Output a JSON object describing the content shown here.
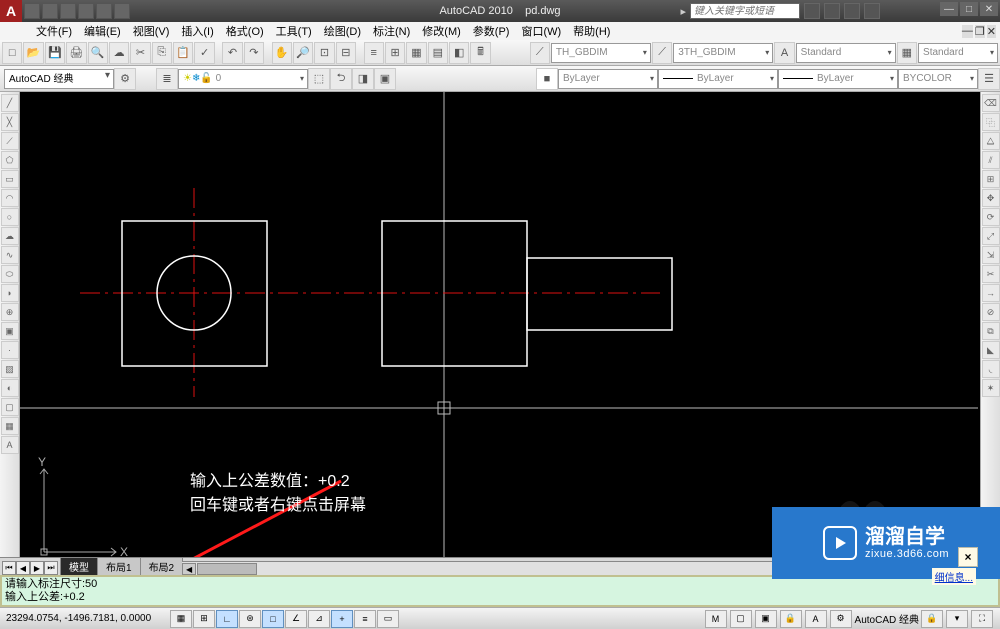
{
  "title": {
    "app": "AutoCAD 2010",
    "file": "pd.dwg"
  },
  "search_placeholder": "键入关键字或短语",
  "menus": [
    "文件(F)",
    "编辑(E)",
    "视图(V)",
    "插入(I)",
    "格式(O)",
    "工具(T)",
    "绘图(D)",
    "标注(N)",
    "修改(M)",
    "参数(P)",
    "窗口(W)",
    "帮助(H)"
  ],
  "workspace": "AutoCAD 经典",
  "dimstyle1": "TH_GBDIM",
  "dimstyle2": "3TH_GBDIM",
  "textstyle": "Standard",
  "tablestyle": "Standard",
  "layer_current": "0",
  "prop_layer": "ByLayer",
  "prop_color": "ByLayer",
  "prop_ltype": "ByLayer",
  "prop_lweight": "BYCOLOR",
  "annotation": {
    "line1": "输入上公差数值：+0.2",
    "line2": "回车键或者右键点击屏幕"
  },
  "tabs": {
    "model": "模型",
    "layout1": "布局1",
    "layout2": "布局2"
  },
  "cmd": {
    "line1": "请输入标注尺寸:50",
    "line2": "输入上公差:+0.2"
  },
  "status": {
    "coords": "23294.0754, -1496.7181, 0.0000",
    "ws_label": "AutoCAD 经典"
  },
  "watermark": {
    "brand": "溜溜自学",
    "url": "zixue.3d66.com"
  },
  "infolink": "细信息...",
  "closebox": "×",
  "winbtns": {
    "min": "—",
    "max": "□",
    "close": "✕"
  }
}
